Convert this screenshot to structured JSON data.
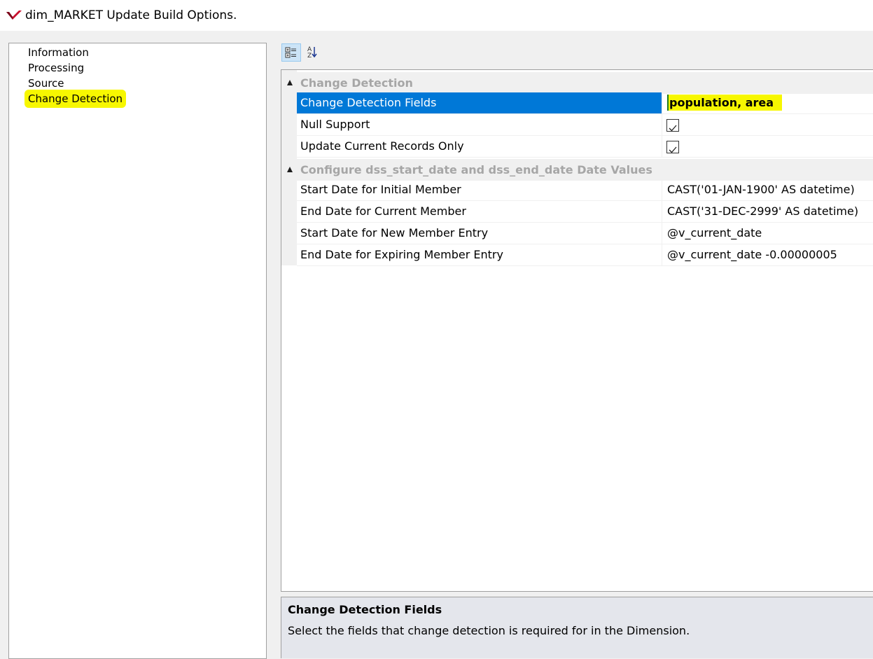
{
  "window": {
    "title": "dim_MARKET Update Build Options."
  },
  "nav": {
    "items": [
      {
        "label": "Information"
      },
      {
        "label": "Processing"
      },
      {
        "label": "Source"
      },
      {
        "label": "Change Detection"
      }
    ],
    "selected": "Change Detection"
  },
  "toolbar": {
    "categorized_icon": "categorized-icon",
    "alphabetical_icon": "sort-az-icon"
  },
  "grid": {
    "categories": [
      {
        "label": "Change Detection",
        "rows": [
          {
            "name": "Change Detection Fields",
            "value": "population, area"
          },
          {
            "name": "Null Support",
            "value": "checked"
          },
          {
            "name": "Update Current Records Only",
            "value": "checked"
          }
        ]
      },
      {
        "label": "Configure dss_start_date and dss_end_date Date Values",
        "rows": [
          {
            "name": "Start Date for Initial Member",
            "value": "CAST('01-JAN-1900' AS datetime)"
          },
          {
            "name": "End Date for Current Member",
            "value": "CAST('31-DEC-2999' AS datetime)"
          },
          {
            "name": "Start Date for New Member Entry",
            "value": "@v_current_date"
          },
          {
            "name": "End Date for Expiring Member Entry",
            "value": "@v_current_date -0.00000005"
          }
        ]
      }
    ]
  },
  "help": {
    "title": "Change Detection Fields",
    "description": "Select the fields that change detection is required for in the Dimension."
  },
  "colors": {
    "selection": "#0078d7",
    "highlight": "#f7f700"
  }
}
